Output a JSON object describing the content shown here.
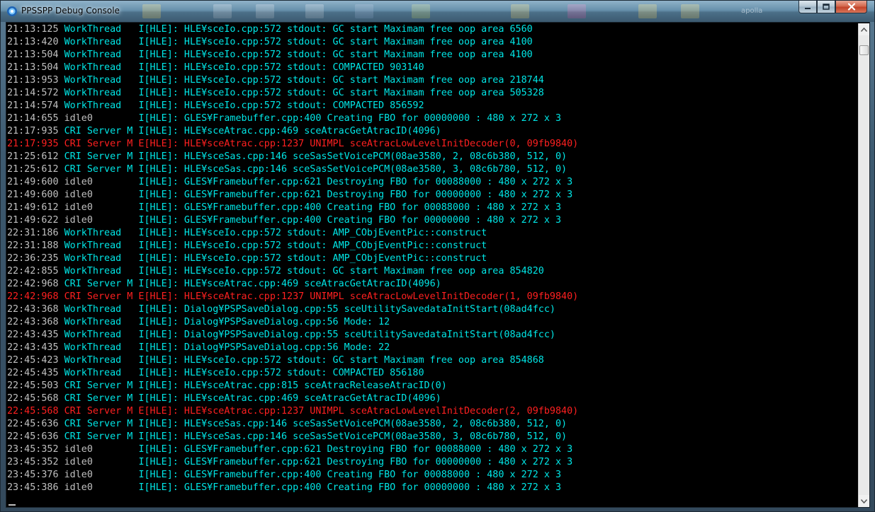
{
  "window": {
    "title": "PPSSPP Debug Console",
    "background_hint": "apolla"
  },
  "colors": {
    "normal_text": "#c0c0c0",
    "info_text": "#00e6e6",
    "error_text": "#ff2020",
    "background": "#000000"
  },
  "log": [
    {
      "time": "21:13:125",
      "thread": "WorkThread  ",
      "lvl": "I[HLE]:",
      "msg": " HLE¥sceIo.cpp:572 stdout: GC start Maximam free oop area 6560",
      "tc": "cyan",
      "mc": "cyan"
    },
    {
      "time": "21:13:420",
      "thread": "WorkThread  ",
      "lvl": "I[HLE]:",
      "msg": " HLE¥sceIo.cpp:572 stdout: GC start Maximam free oop area 4100",
      "tc": "cyan",
      "mc": "cyan"
    },
    {
      "time": "21:13:504",
      "thread": "WorkThread  ",
      "lvl": "I[HLE]:",
      "msg": " HLE¥sceIo.cpp:572 stdout: GC start Maximam free oop area 4100",
      "tc": "cyan",
      "mc": "cyan"
    },
    {
      "time": "21:13:504",
      "thread": "WorkThread  ",
      "lvl": "I[HLE]:",
      "msg": " HLE¥sceIo.cpp:572 stdout: COMPACTED 903140",
      "tc": "cyan",
      "mc": "cyan"
    },
    {
      "time": "21:13:953",
      "thread": "WorkThread  ",
      "lvl": "I[HLE]:",
      "msg": " HLE¥sceIo.cpp:572 stdout: GC start Maximam free oop area 218744",
      "tc": "cyan",
      "mc": "cyan"
    },
    {
      "time": "21:14:572",
      "thread": "WorkThread  ",
      "lvl": "I[HLE]:",
      "msg": " HLE¥sceIo.cpp:572 stdout: GC start Maximam free oop area 505328",
      "tc": "cyan",
      "mc": "cyan"
    },
    {
      "time": "21:14:574",
      "thread": "WorkThread  ",
      "lvl": "I[HLE]:",
      "msg": " HLE¥sceIo.cpp:572 stdout: COMPACTED 856592",
      "tc": "cyan",
      "mc": "cyan"
    },
    {
      "time": "21:14:655",
      "thread": "idle0       ",
      "lvl": "I[HLE]:",
      "msg": " GLES¥Framebuffer.cpp:400 Creating FBO for 00000000 : 480 x 272 x 3",
      "tc": "gray",
      "mc": "cyan"
    },
    {
      "time": "21:17:935",
      "thread": "CRI Server M",
      "lvl": " I[HLE]:",
      "msg": " HLE¥sceAtrac.cpp:469 sceAtracGetAtracID(4096)",
      "tc": "cyan",
      "mc": "cyan"
    },
    {
      "time": "21:17:935",
      "thread": "CRI Server M",
      "lvl": " E[HLE]:",
      "msg": " HLE¥sceAtrac.cpp:1237 UNIMPL sceAtracLowLevelInitDecoder(0, 09fb9840)",
      "tc": "red",
      "mc": "red"
    },
    {
      "time": "21:25:612",
      "thread": "CRI Server M",
      "lvl": " I[HLE]:",
      "msg": " HLE¥sceSas.cpp:146 sceSasSetVoicePCM(08ae3580, 2, 08c6b380, 512, 0)",
      "tc": "cyan",
      "mc": "cyan"
    },
    {
      "time": "21:25:612",
      "thread": "CRI Server M",
      "lvl": " I[HLE]:",
      "msg": " HLE¥sceSas.cpp:146 sceSasSetVoicePCM(08ae3580, 3, 08c6b780, 512, 0)",
      "tc": "cyan",
      "mc": "cyan"
    },
    {
      "time": "21:49:600",
      "thread": "idle0       ",
      "lvl": "I[HLE]:",
      "msg": " GLES¥Framebuffer.cpp:621 Destroying FBO for 00088000 : 480 x 272 x 3",
      "tc": "gray",
      "mc": "cyan"
    },
    {
      "time": "21:49:600",
      "thread": "idle0       ",
      "lvl": "I[HLE]:",
      "msg": " GLES¥Framebuffer.cpp:621 Destroying FBO for 00000000 : 480 x 272 x 3",
      "tc": "gray",
      "mc": "cyan"
    },
    {
      "time": "21:49:612",
      "thread": "idle0       ",
      "lvl": "I[HLE]:",
      "msg": " GLES¥Framebuffer.cpp:400 Creating FBO for 00088000 : 480 x 272 x 3",
      "tc": "gray",
      "mc": "cyan"
    },
    {
      "time": "21:49:622",
      "thread": "idle0       ",
      "lvl": "I[HLE]:",
      "msg": " GLES¥Framebuffer.cpp:400 Creating FBO for 00000000 : 480 x 272 x 3",
      "tc": "gray",
      "mc": "cyan"
    },
    {
      "time": "22:31:186",
      "thread": "WorkThread  ",
      "lvl": "I[HLE]:",
      "msg": " HLE¥sceIo.cpp:572 stdout: AMP_CObjEventPic::construct",
      "tc": "cyan",
      "mc": "cyan"
    },
    {
      "time": "22:31:188",
      "thread": "WorkThread  ",
      "lvl": "I[HLE]:",
      "msg": " HLE¥sceIo.cpp:572 stdout: AMP_CObjEventPic::construct",
      "tc": "cyan",
      "mc": "cyan"
    },
    {
      "time": "22:36:235",
      "thread": "WorkThread  ",
      "lvl": "I[HLE]:",
      "msg": " HLE¥sceIo.cpp:572 stdout: AMP_CObjEventPic::construct",
      "tc": "cyan",
      "mc": "cyan"
    },
    {
      "time": "22:42:855",
      "thread": "WorkThread  ",
      "lvl": "I[HLE]:",
      "msg": " HLE¥sceIo.cpp:572 stdout: GC start Maximam free oop area 854820",
      "tc": "cyan",
      "mc": "cyan"
    },
    {
      "time": "22:42:968",
      "thread": "CRI Server M",
      "lvl": " I[HLE]:",
      "msg": " HLE¥sceAtrac.cpp:469 sceAtracGetAtracID(4096)",
      "tc": "cyan",
      "mc": "cyan"
    },
    {
      "time": "22:42:968",
      "thread": "CRI Server M",
      "lvl": " E[HLE]:",
      "msg": " HLE¥sceAtrac.cpp:1237 UNIMPL sceAtracLowLevelInitDecoder(1, 09fb9840)",
      "tc": "red",
      "mc": "red"
    },
    {
      "time": "22:43:368",
      "thread": "WorkThread  ",
      "lvl": "I[HLE]:",
      "msg": " Dialog¥PSPSaveDialog.cpp:55 sceUtilitySavedataInitStart(08ad4fcc)",
      "tc": "cyan",
      "mc": "cyan"
    },
    {
      "time": "22:43:368",
      "thread": "WorkThread  ",
      "lvl": "I[HLE]:",
      "msg": " Dialog¥PSPSaveDialog.cpp:56 Mode: 12",
      "tc": "cyan",
      "mc": "cyan"
    },
    {
      "time": "22:43:435",
      "thread": "WorkThread  ",
      "lvl": "I[HLE]:",
      "msg": " Dialog¥PSPSaveDialog.cpp:55 sceUtilitySavedataInitStart(08ad4fcc)",
      "tc": "cyan",
      "mc": "cyan"
    },
    {
      "time": "22:43:435",
      "thread": "WorkThread  ",
      "lvl": "I[HLE]:",
      "msg": " Dialog¥PSPSaveDialog.cpp:56 Mode: 22",
      "tc": "cyan",
      "mc": "cyan"
    },
    {
      "time": "22:45:423",
      "thread": "WorkThread  ",
      "lvl": "I[HLE]:",
      "msg": " HLE¥sceIo.cpp:572 stdout: GC start Maximam free oop area 854868",
      "tc": "cyan",
      "mc": "cyan"
    },
    {
      "time": "22:45:435",
      "thread": "WorkThread  ",
      "lvl": "I[HLE]:",
      "msg": " HLE¥sceIo.cpp:572 stdout: COMPACTED 856180",
      "tc": "cyan",
      "mc": "cyan"
    },
    {
      "time": "22:45:503",
      "thread": "CRI Server M",
      "lvl": " I[HLE]:",
      "msg": " HLE¥sceAtrac.cpp:815 sceAtracReleaseAtracID(0)",
      "tc": "cyan",
      "mc": "cyan"
    },
    {
      "time": "22:45:568",
      "thread": "CRI Server M",
      "lvl": " I[HLE]:",
      "msg": " HLE¥sceAtrac.cpp:469 sceAtracGetAtracID(4096)",
      "tc": "cyan",
      "mc": "cyan"
    },
    {
      "time": "22:45:568",
      "thread": "CRI Server M",
      "lvl": " E[HLE]:",
      "msg": " HLE¥sceAtrac.cpp:1237 UNIMPL sceAtracLowLevelInitDecoder(2, 09fb9840)",
      "tc": "red",
      "mc": "red"
    },
    {
      "time": "22:45:636",
      "thread": "CRI Server M",
      "lvl": " I[HLE]:",
      "msg": " HLE¥sceSas.cpp:146 sceSasSetVoicePCM(08ae3580, 2, 08c6b380, 512, 0)",
      "tc": "cyan",
      "mc": "cyan"
    },
    {
      "time": "22:45:636",
      "thread": "CRI Server M",
      "lvl": " I[HLE]:",
      "msg": " HLE¥sceSas.cpp:146 sceSasSetVoicePCM(08ae3580, 3, 08c6b780, 512, 0)",
      "tc": "cyan",
      "mc": "cyan"
    },
    {
      "time": "23:45:352",
      "thread": "idle0       ",
      "lvl": "I[HLE]:",
      "msg": " GLES¥Framebuffer.cpp:621 Destroying FBO for 00088000 : 480 x 272 x 3",
      "tc": "gray",
      "mc": "cyan"
    },
    {
      "time": "23:45:352",
      "thread": "idle0       ",
      "lvl": "I[HLE]:",
      "msg": " GLES¥Framebuffer.cpp:621 Destroying FBO for 00000000 : 480 x 272 x 3",
      "tc": "gray",
      "mc": "cyan"
    },
    {
      "time": "23:45:376",
      "thread": "idle0       ",
      "lvl": "I[HLE]:",
      "msg": " GLES¥Framebuffer.cpp:400 Creating FBO for 00088000 : 480 x 272 x 3",
      "tc": "gray",
      "mc": "cyan"
    },
    {
      "time": "23:45:386",
      "thread": "idle0       ",
      "lvl": "I[HLE]:",
      "msg": " GLES¥Framebuffer.cpp:400 Creating FBO for 00000000 : 480 x 272 x 3",
      "tc": "gray",
      "mc": "cyan"
    }
  ]
}
